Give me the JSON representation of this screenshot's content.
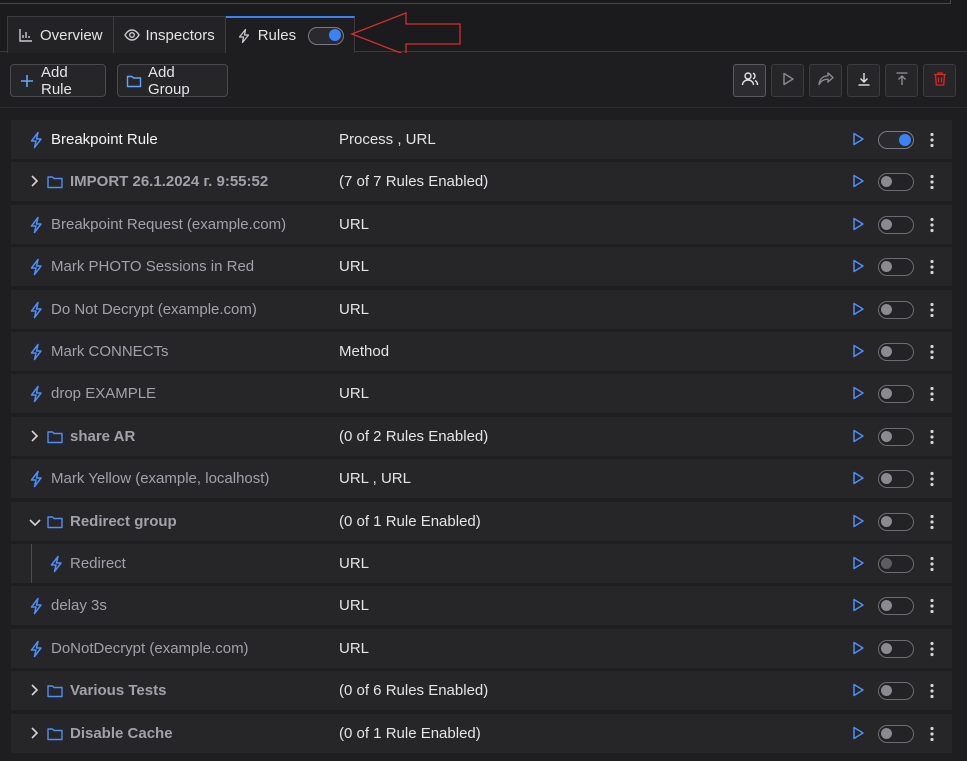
{
  "tabs": [
    {
      "label": "Overview",
      "icon": "chart-icon"
    },
    {
      "label": "Inspectors",
      "icon": "eye-icon"
    },
    {
      "label": "Rules",
      "icon": "bolt-icon",
      "active": true,
      "toggle_on": true
    }
  ],
  "toolbar": {
    "add_rule_label": "Add Rule",
    "add_group_label": "Add Group",
    "icon_buttons": [
      "users-icon",
      "play-icon",
      "share-icon",
      "download-icon",
      "upload-icon",
      "trash-icon"
    ]
  },
  "rules": [
    {
      "kind": "rule",
      "name": "Breakpoint Rule",
      "condition": "Process , URL",
      "enabled": true,
      "level": 0
    },
    {
      "kind": "group",
      "name": "IMPORT 26.1.2024 г. 9:55:52",
      "condition": "(7 of 7 Rules Enabled)",
      "expanded": false,
      "enabled": false,
      "level": 0
    },
    {
      "kind": "rule",
      "name": "Breakpoint Request (example.com)",
      "condition": "URL",
      "enabled": false,
      "level": 0
    },
    {
      "kind": "rule",
      "name": "Mark PHOTO Sessions in Red",
      "condition": "URL",
      "enabled": false,
      "level": 0
    },
    {
      "kind": "rule",
      "name": "Do Not Decrypt (example.com)",
      "condition": "URL",
      "enabled": false,
      "level": 0
    },
    {
      "kind": "rule",
      "name": "Mark CONNECTs",
      "condition": "Method",
      "enabled": false,
      "level": 0
    },
    {
      "kind": "rule",
      "name": "drop EXAMPLE",
      "condition": "URL",
      "enabled": false,
      "level": 0
    },
    {
      "kind": "group",
      "name": "share AR",
      "condition": "(0 of 2 Rules Enabled)",
      "expanded": false,
      "enabled": false,
      "level": 0
    },
    {
      "kind": "rule",
      "name": "Mark Yellow (example, localhost)",
      "condition": "URL , URL",
      "enabled": false,
      "level": 0
    },
    {
      "kind": "group",
      "name": "Redirect group",
      "condition": "(0 of 1 Rule Enabled)",
      "expanded": true,
      "enabled": false,
      "level": 0
    },
    {
      "kind": "rule",
      "name": "Redirect",
      "condition": "URL",
      "enabled": false,
      "level": 1,
      "dim": true
    },
    {
      "kind": "rule",
      "name": "delay 3s",
      "condition": "URL",
      "enabled": false,
      "level": 0
    },
    {
      "kind": "rule",
      "name": "DoNotDecrypt (example.com)",
      "condition": "URL",
      "enabled": false,
      "level": 0
    },
    {
      "kind": "group",
      "name": "Various Tests",
      "condition": "(0 of 6 Rules Enabled)",
      "expanded": false,
      "enabled": false,
      "level": 0
    },
    {
      "kind": "group",
      "name": "Disable Cache",
      "condition": "(0 of 1 Rule Enabled)",
      "expanded": false,
      "enabled": false,
      "level": 0
    }
  ],
  "colors": {
    "accent": "#3b82f6",
    "danger": "#dc2626",
    "annotation": "#d32f2f"
  }
}
